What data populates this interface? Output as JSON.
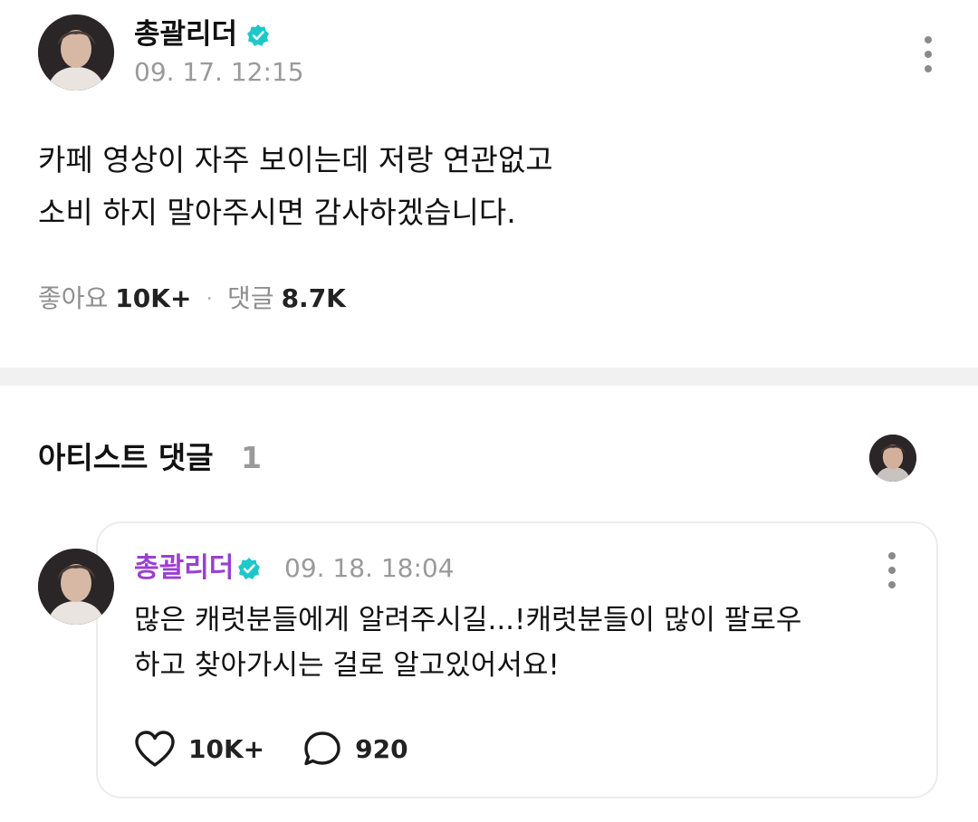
{
  "post": {
    "author": "총괄리더",
    "timestamp": "09. 17. 12:15",
    "body_lines": [
      "카페 영상이 자주 보이는데 저랑 연관없고",
      "소비 하지 말아주시면 감사하겠습니다."
    ],
    "likes_label": "좋아요",
    "likes_value": "10K+",
    "separator": "·",
    "comments_label": "댓글",
    "comments_value": "8.7K"
  },
  "artist_comments": {
    "title": "아티스트 댓글",
    "count": "1"
  },
  "comment": {
    "author": "총괄리더",
    "timestamp": "09. 18. 18:04",
    "body_lines": [
      "많은 캐럿분들에게 알려주시길...!캐럿분들이 많이 팔로우",
      "하고 찾아가시는 걸로 알고있어서요!"
    ],
    "like_count": "10K+",
    "reply_count": "920"
  },
  "colors": {
    "verified_badge": "#1ec8c8",
    "comment_author": "#9b3fcf",
    "muted_text": "#9a9a9a",
    "divider": "#f1f1f1"
  },
  "icons": {
    "verified": "verified-badge-icon",
    "more": "more-vertical-icon",
    "like": "heart-icon",
    "reply": "comment-bubble-icon"
  }
}
